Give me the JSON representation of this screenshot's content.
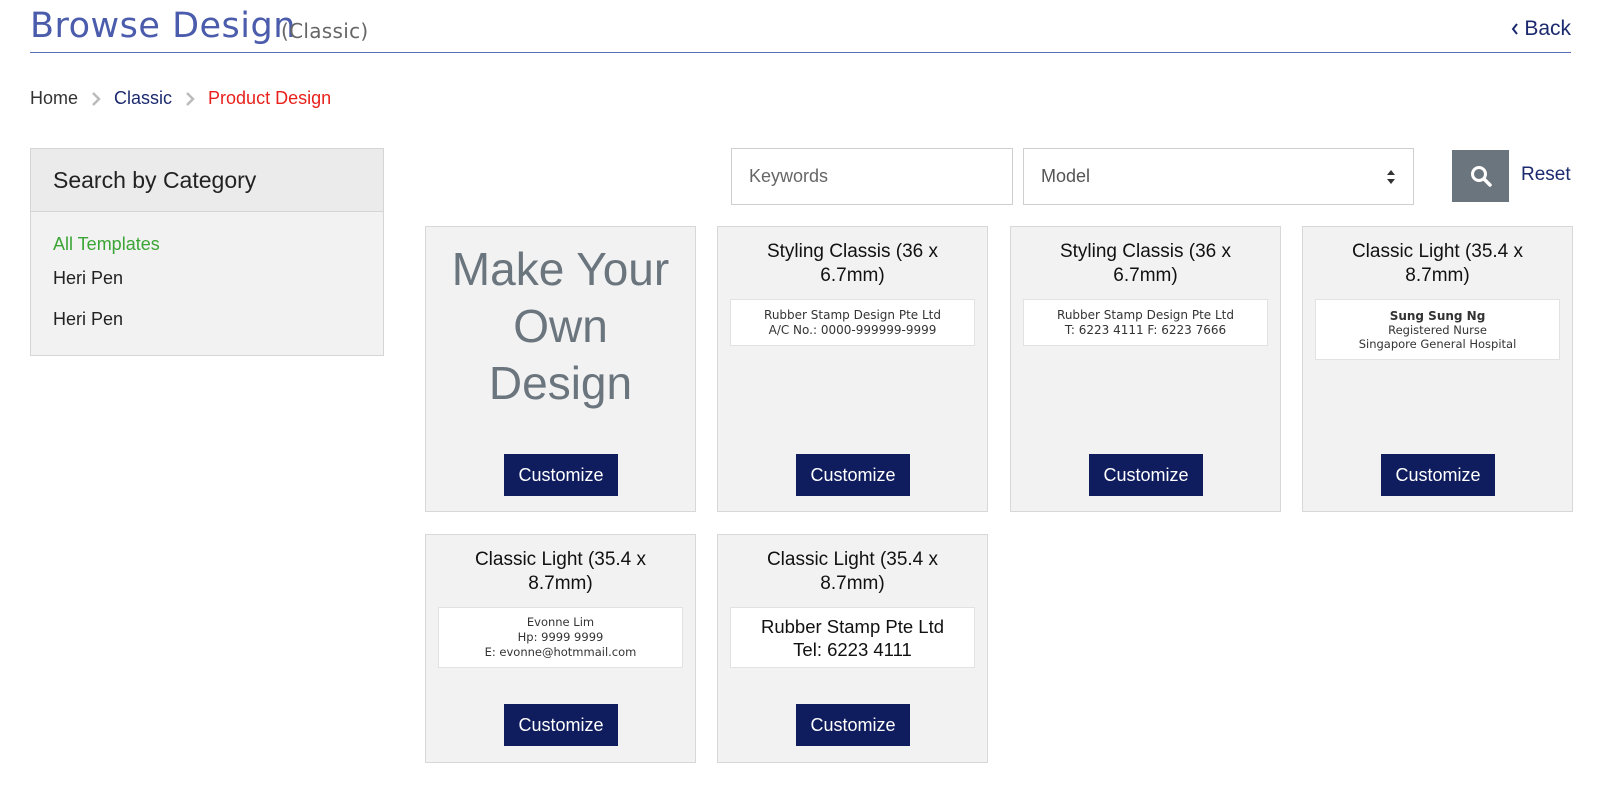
{
  "header": {
    "title": "Browse Design",
    "subtitle": "(Classic)",
    "back_label": "Back"
  },
  "breadcrumb": {
    "home": "Home",
    "classic": "Classic",
    "current": "Product Design"
  },
  "sidebar": {
    "heading": "Search by Category",
    "items": [
      {
        "label": "All Templates",
        "active": true
      },
      {
        "label": "Heri Pen",
        "active": false
      },
      {
        "label": "Heri Pen",
        "active": false
      }
    ]
  },
  "search": {
    "keywords_placeholder": "Keywords",
    "model_label": "Model",
    "search_icon": "search-icon",
    "reset_label": "Reset"
  },
  "make_own": {
    "line1": "Make Your",
    "line2": "Own",
    "line3": "Design",
    "button_label": "Customize"
  },
  "products": [
    {
      "title_line1": "Styling Classis (36 x",
      "title_line2": "6.7mm)",
      "preview_lines": [
        "Rubber Stamp Design Pte Ltd",
        "A/C No.: 0000-999999-9999"
      ],
      "button_label": "Customize"
    },
    {
      "title_line1": "Styling Classis (36 x",
      "title_line2": "6.7mm)",
      "preview_lines": [
        "Rubber Stamp Design Pte Ltd",
        "T: 6223 4111   F: 6223 7666"
      ],
      "button_label": "Customize"
    },
    {
      "title_line1": "Classic Light (35.4 x",
      "title_line2": "8.7mm)",
      "preview_lines": [
        "Sung Sung Ng",
        "Registered Nurse",
        "Singapore General Hospital"
      ],
      "button_label": "Customize"
    },
    {
      "title_line1": "Classic Light (35.4 x",
      "title_line2": "8.7mm)",
      "preview_lines": [
        "Evonne Lim",
        "Hp: 9999 9999",
        "E: evonne@hotmmail.com"
      ],
      "button_label": "Customize"
    },
    {
      "title_line1": "Classic Light (35.4 x",
      "title_line2": "8.7mm)",
      "preview_lines": [
        "Rubber Stamp Pte Ltd",
        "Tel: 6223 4111"
      ],
      "button_label": "Customize"
    }
  ],
  "colors": {
    "title_blue": "#4a5cab",
    "navy": "#0f1c5e",
    "active_green": "#3aa534",
    "breadcrumb_red": "#e8211c",
    "search_gray": "#6b757e"
  }
}
